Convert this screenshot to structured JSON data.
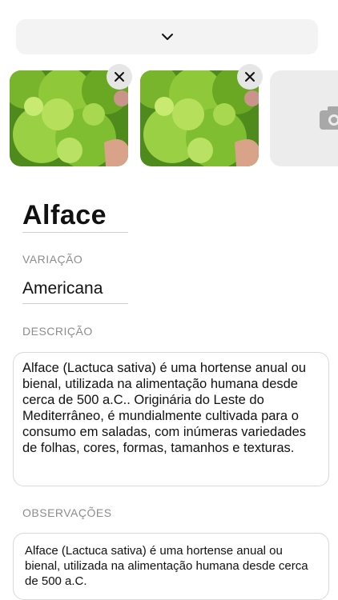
{
  "header": {
    "collapse_icon": "chevron-down-icon"
  },
  "photos": {
    "items": [
      {
        "alt": "lettuce-photo",
        "remove_icon": "close-icon"
      },
      {
        "alt": "lettuce-photo",
        "remove_icon": "close-icon"
      }
    ],
    "add_icon": "camera-icon"
  },
  "plant": {
    "name": "Alface"
  },
  "variation": {
    "label": "VARIAÇÃO",
    "value": "Americana"
  },
  "description": {
    "label": "DESCRIÇÃO",
    "text": "Alface (Lactuca sativa) é uma hortense anual ou bienal, utilizada na alimentação humana desde cerca de 500 a.C.. Originária do Leste do Mediterrâneo, é mundialmente cultivada para o consumo em saladas, com inúmeras variedades de folhas, cores, formas, tamanhos e texturas."
  },
  "observations": {
    "label": "OBSERVAÇÕES",
    "text": "Alface (Lactuca sativa) é uma hortense anual ou bienal, utilizada na alimentação humana desde cerca de 500 a.C."
  }
}
